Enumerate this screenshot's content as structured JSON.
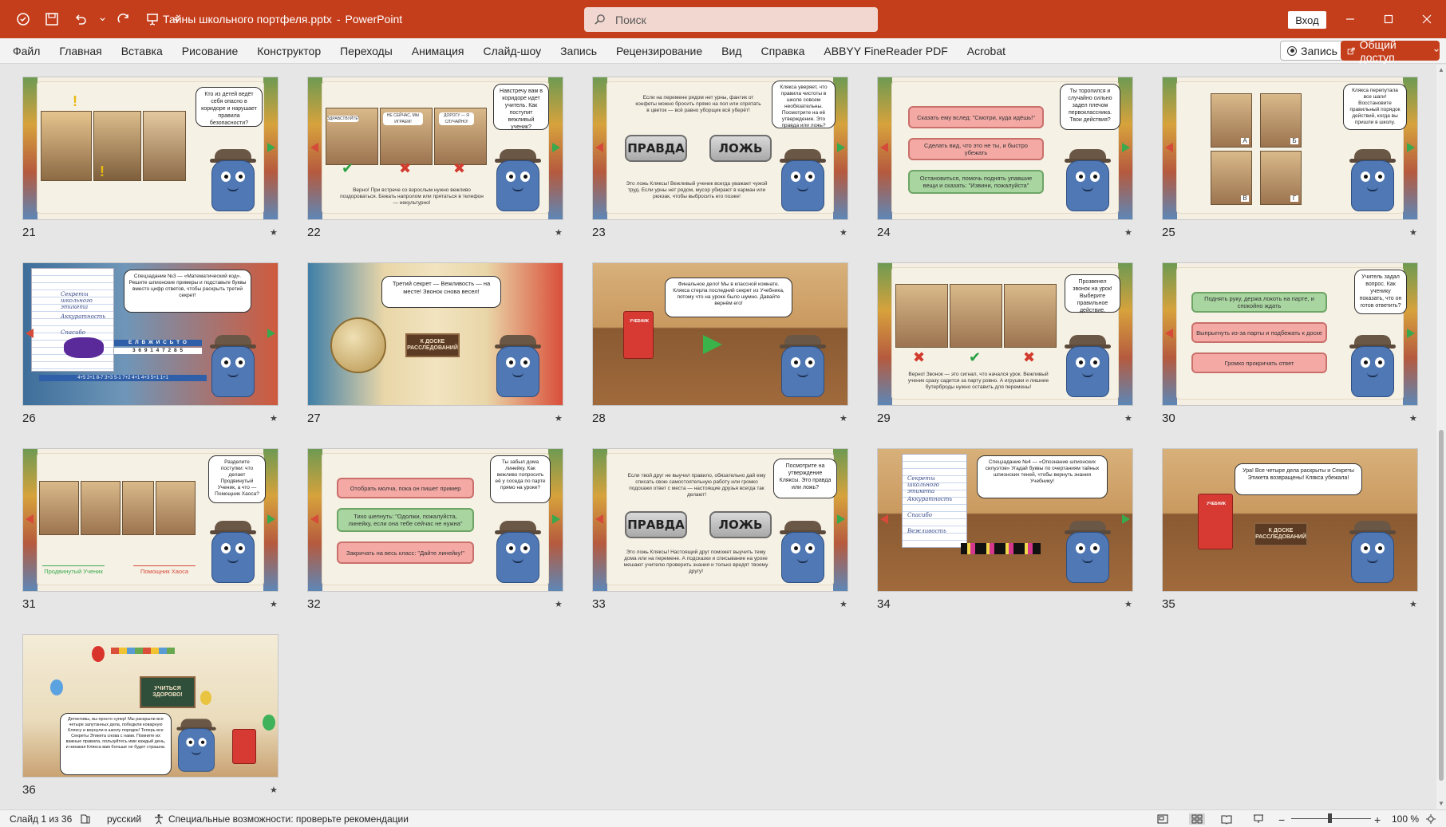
{
  "app": {
    "doc_title": "Тайны школьного портфеля.pptx",
    "separator": "-",
    "app_name": "PowerPoint",
    "search_placeholder": "Поиск",
    "signin_label": "Вход"
  },
  "ribbon": {
    "tabs": [
      "Файл",
      "Главная",
      "Вставка",
      "Рисование",
      "Конструктор",
      "Переходы",
      "Анимация",
      "Слайд-шоу",
      "Запись",
      "Рецензирование",
      "Вид",
      "Справка",
      "ABBYY FineReader PDF",
      "Acrobat"
    ],
    "record_label": "Запись",
    "share_label": "Общий доступ"
  },
  "slides": [
    {
      "num": "21",
      "bubble": "Кто из детей ведёт себя опасно в коридоре и нарушает правила безопасности?"
    },
    {
      "num": "22",
      "bubble": "Навстречу вам в коридоре идет учитель. Как поступит вежливый ученик?",
      "captions": [
        "ЗДРАВСТВУЙТЕ!",
        "НЕ СЕЙЧАС, МЫ ИГРАЕМ!",
        "ДОРОГУ — Я СЛУЧАЙНО!"
      ],
      "footer": "Верно! При встрече со взрослым нужно вежливо поздороваться. Бежать напролом или прятаться в телефон — некультурно!"
    },
    {
      "num": "23",
      "bubble": "Клякса уверяет, что правила чистоты в школе совсем необязательны. Посмотрите на её утверждение. Это правда или ложь?",
      "question": "Если на перемене рядом нет урны, фантик от конфеты можно бросить прямо на пол или спрятать в цветок — всё равно уборщик всё уберёт!",
      "true_label": "ПРАВДА",
      "false_label": "ЛОЖЬ",
      "footer": "Это ложь Кляксы! Вежливый ученик всегда уважает чужой труд. Если урны нет рядом, мусор убирают в карман или рюкзак, чтобы выбросить его позже!"
    },
    {
      "num": "24",
      "bubble": "Ты торопился и случайно сильно задел плечом первоклассника. Твои действия?",
      "options": [
        "Сказать ему вслед: \"Смотри, куда идёшь!\"",
        "Сделать вид, что это не ты, и быстро убежать",
        "Остановиться, помочь поднять упавшие вещи и сказать: \"Извини, пожалуйста\""
      ]
    },
    {
      "num": "25",
      "bubble": "Клякса перепутала все шаги! Восстановите правильный порядок действий, когда вы пришли в школу.",
      "letters": [
        "А",
        "Б",
        "В",
        "Г"
      ]
    },
    {
      "num": "26",
      "bubble": "Спецзадание №3 — «Математический код». Решите шпионские примеры и подставьте буквы вместо цифр ответов, чтобы раскрыть третий секрет!",
      "notebook": [
        "Секреты школьного этикета",
        "Аккуратность",
        "Спасибо"
      ],
      "code_letters": "Е Л В Ж И С Ь Т О",
      "code_digits": "3 6 9 1 4 7 2 8 5",
      "sums": "4+5  2+1  8-7  3+3  5-1  7+2  4+1  4+3  5+1  1+1"
    },
    {
      "num": "27",
      "bubble": "Третий секрет — Вежливость — на месте! Звонок снова весел!",
      "board": "К ДОСКЕ РАССЛЕДОВАНИЙ"
    },
    {
      "num": "28",
      "bubble": "Финальное дело! Мы в классной комнате. Клякса стерла последний секрет из Учебника, потому что на уроке было шумно. Давайте вернём его!",
      "book_label": "УЧЕБНИК"
    },
    {
      "num": "29",
      "bubble": "Прозвенел звонок на урок! Выберите правильное действие.",
      "footer": "Верно! Звонок — это сигнал, что начался урок. Вежливый ученик сразу садится за парту ровно. А игрушки и лишние бутерброды нужно оставить для перемены!"
    },
    {
      "num": "30",
      "bubble": "Учитель задал вопрос. Как ученику показать, что он готов ответить?",
      "options": [
        "Поднять руку, держа локоть на парте, и спокойно ждать",
        "Выпрыгнуть из-за парты и подбежать к доске",
        "Громко прокричать ответ"
      ]
    },
    {
      "num": "31",
      "bubble": "Разделите поступки: что делает Продвинутый Ученик, а что — Помощник Хаоса?",
      "col_left": "Продвинутый Ученик",
      "col_right": "Помощник Хаоса"
    },
    {
      "num": "32",
      "bubble": "Ты забыл дома линейку. Как вежливо попросить её у соседа по парте прямо на уроке?",
      "options": [
        "Отобрать молча, пока он пишет пример",
        "Тихо шепнуть: \"Одолжи, пожалуйста, линейку, если она тебе сейчас не нужна\"",
        "Закричать на весь класс: \"Дайте линейку!\""
      ]
    },
    {
      "num": "33",
      "bubble": "Посмотрите на утверждение Кляксы. Это правда или ложь?",
      "question": "Если твой друг не выучил правило, обязательно дай ему списать свою самостоятельную работу или громко подскажи ответ с места — настоящие друзья всегда так делают!",
      "true_label": "ПРАВДА",
      "false_label": "ЛОЖЬ",
      "footer": "Это ложь Кляксы! Настоящий друг поможет выучить тему дома или на перемене. А подсказки и списывание на уроке мешают учителю проверить знания и только вредят твоему другу!"
    },
    {
      "num": "34",
      "bubble": "Спецзадание №4 — «Опознание шпионских силуэтов» Угадай буквы по очертаниям тайных шпионских теней, чтобы вернуть знания Учебнику!",
      "notebook": [
        "Секреты школьного этикета",
        "Аккуратность",
        "Спасибо",
        "Вежливость"
      ]
    },
    {
      "num": "35",
      "bubble": "Ура! Все четыре дела раскрыты и Секреты Этикета возвращены! Клякса убежала!",
      "board": "К ДОСКЕ РАССЛЕДОВАНИЙ",
      "book_label": "УЧЕБНИК"
    },
    {
      "num": "36",
      "bubble": "Детективы, вы просто супер! Мы раскрыли все четыре запутанных дела, победили коварную Кляксу и вернули в школу порядок! Теперь все Секреты Этикета снова с нами. Помните их важные правила, пользуйтесь ими каждый день, и никакая Клякса вам больше не будет страшна.",
      "board": "УЧИТЬСЯ ЗДОРОВО!"
    }
  ],
  "status": {
    "slide_info": "Слайд 1 из 36",
    "language": "русский",
    "accessibility": "Специальные возможности: проверьте рекомендации",
    "zoom": "100 %"
  },
  "colors": {
    "brand": "#c43e1c",
    "true_green": "#39a94e",
    "false_red": "#d64a3a"
  }
}
